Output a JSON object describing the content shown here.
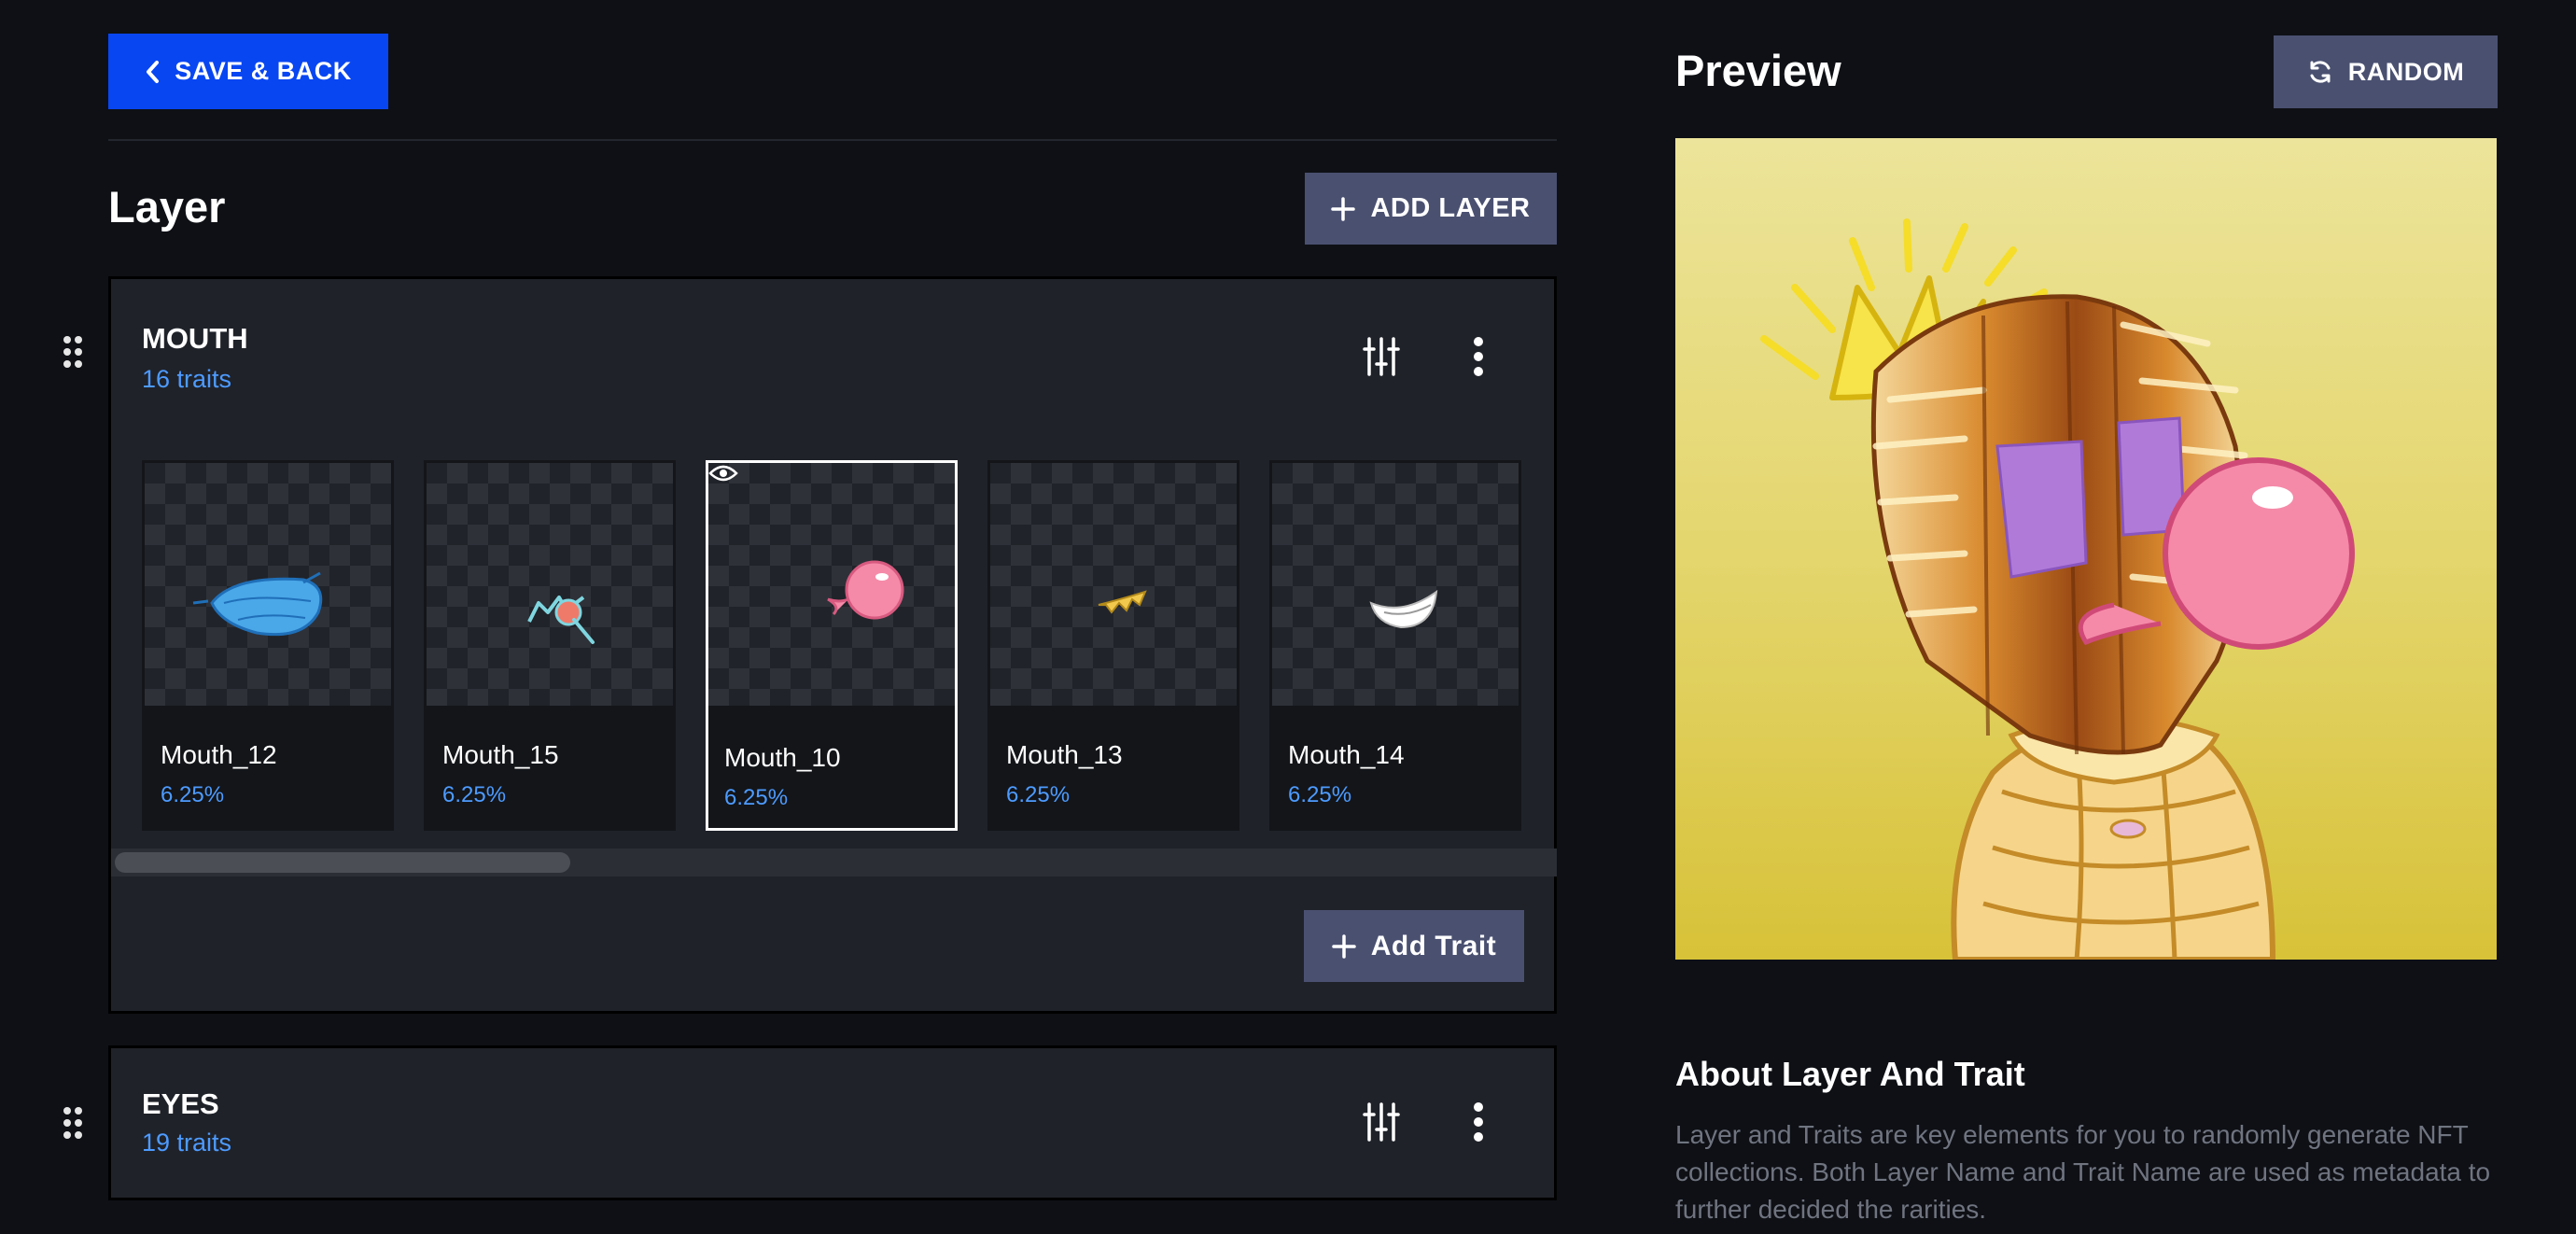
{
  "toolbar": {
    "save_back_label": "SAVE & BACK"
  },
  "layer_section": {
    "title": "Layer",
    "add_layer_label": "ADD LAYER"
  },
  "layers": [
    {
      "name": "MOUTH",
      "count": "16 traits",
      "traits": [
        {
          "name": "Mouth_12",
          "percent": "6.25%",
          "icon": "blue-face-mask"
        },
        {
          "name": "Mouth_15",
          "percent": "6.25%",
          "icon": "lollipop-mouth"
        },
        {
          "name": "Mouth_10",
          "percent": "6.25%",
          "icon": "pink-bubblegum",
          "selected": true
        },
        {
          "name": "Mouth_13",
          "percent": "6.25%",
          "icon": "gold-teeth"
        },
        {
          "name": "Mouth_14",
          "percent": "6.25%",
          "icon": "white-grin"
        }
      ],
      "add_trait_label": "Add Trait"
    },
    {
      "name": "EYES",
      "count": "19 traits"
    }
  ],
  "preview": {
    "title": "Preview",
    "random_label": "RANDOM"
  },
  "about": {
    "title": "About Layer And Trait",
    "text": "Layer and Traits are key elements for you to randomly generate NFT collections. Both Layer Name and Trait Name are used as metadata to further decided the rarities."
  },
  "colors": {
    "primary": "#0846f2",
    "secondary_button": "#4a5070",
    "link": "#4d9bff",
    "panel": "#1f2229",
    "background": "#0e1015"
  }
}
